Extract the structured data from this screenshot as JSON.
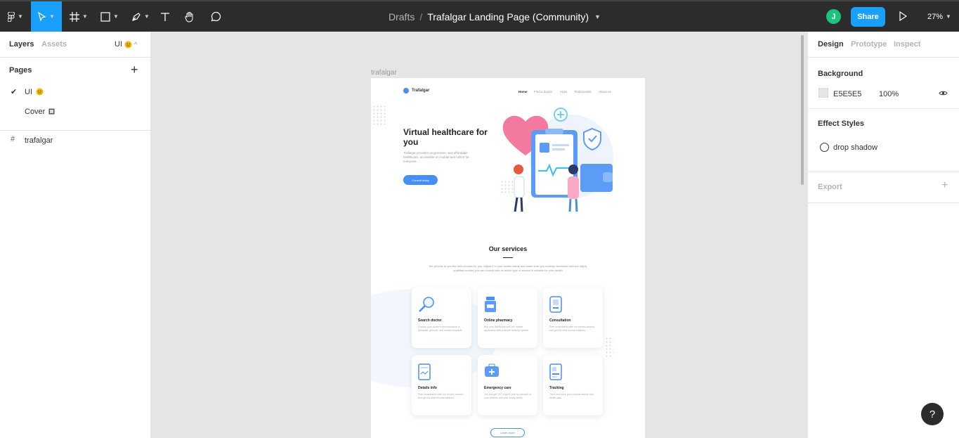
{
  "toolbar": {
    "breadcrumb_root": "Drafts",
    "breadcrumb_sep": "/",
    "document_title": "Trafalgar Landing Page (Community)",
    "avatar_initial": "J",
    "share_label": "Share",
    "zoom_level": "27%",
    "active_tool": "move"
  },
  "left_panel": {
    "tab_layers": "Layers",
    "tab_assets": "Assets",
    "current_page_short": "UI",
    "pages_heading": "Pages",
    "pages": [
      {
        "name": "UI",
        "selected": true
      },
      {
        "name": "Cover",
        "selected": false
      }
    ],
    "layers": [
      {
        "name": "trafalgar",
        "type": "frame"
      }
    ]
  },
  "canvas": {
    "frame_label": "trafalgar",
    "frame": {
      "logo_text": "Trafalgar",
      "nav": [
        "Home",
        "Find a doctor",
        "Apps",
        "Testimonials",
        "About us"
      ],
      "hero_title": "Virtual healthcare for you",
      "hero_subtitle": "Trafalgar provides progressive, and affordable healthcare, accessible on mobile and online for everyone",
      "hero_button": "Consult today",
      "services_title": "Our services",
      "services_desc": "We provide to you the best choices for you. Adjust it to your health needs and make sure you undergo treatment with our highly qualified doctors you can consult with us which type of service is suitable for your health",
      "cards": [
        {
          "title": "Search doctor",
          "text": "Choose your doctor from thousands of specialist, general, and trusted hospitals",
          "icon": "search-icon"
        },
        {
          "title": "Online pharmacy",
          "text": "Buy your medicines with our mobile application with a simple delivery system",
          "icon": "pharmacy-icon"
        },
        {
          "title": "Consultation",
          "text": "Free consultation with our trusted doctors and get the best recomendations",
          "icon": "consultation-icon"
        },
        {
          "title": "Details info",
          "text": "Free consultation with our trusted doctors and get the best recomendations",
          "icon": "details-info-icon"
        },
        {
          "title": "Emergency care",
          "text": "You can get 24/7 urgent care for yourself or your children and your lovely family",
          "icon": "emergency-care-icon"
        },
        {
          "title": "Tracking",
          "text": "Track and save your medical history and health data",
          "icon": "tracking-icon"
        }
      ],
      "learn_more": "Learn more"
    }
  },
  "right_panel": {
    "tab_design": "Design",
    "tab_prototype": "Prototype",
    "tab_inspect": "Inspect",
    "background_heading": "Background",
    "background_hex": "E5E5E5",
    "background_opacity": "100%",
    "effect_styles_heading": "Effect Styles",
    "effect_style_name": "drop shadow",
    "export_heading": "Export"
  },
  "help_label": "?",
  "colors": {
    "toolbar_bg": "#2c2c2c",
    "accent": "#18a0fb",
    "canvas_bg": "#e5e5e5",
    "brand_blue": "#458ff6",
    "avatar_green": "#1bc47d"
  }
}
